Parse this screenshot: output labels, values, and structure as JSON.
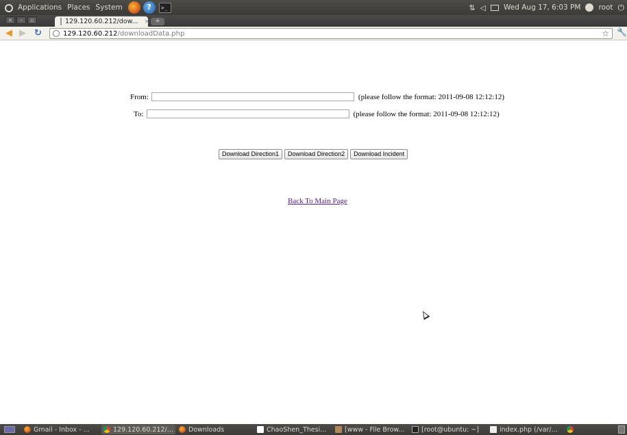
{
  "top_panel": {
    "menus": [
      "Applications",
      "Places",
      "System"
    ],
    "clock": "Wed Aug 17,  6:03 PM",
    "user": "root"
  },
  "browser": {
    "tab_title": "129.120.60.212/dow...",
    "tab_close": "×",
    "url_host": "129.120.60.212",
    "url_path": "/downloadData.php"
  },
  "form": {
    "from_label": "From:",
    "from_value": "",
    "to_label": "To:",
    "to_value": "",
    "format_hint": "(please follow the format: 2011-09-08 12:12:12)",
    "buttons": [
      "Download Direction1",
      "Download Direction2",
      "Download Incident"
    ],
    "back_link": "Back To Main Page"
  },
  "taskbar": {
    "items": [
      {
        "label": "Gmail - Inbox - ...",
        "icon": "firefox-icon"
      },
      {
        "label": "129.120.60.212/...",
        "icon": "chrome-icon"
      },
      {
        "label": "Downloads",
        "icon": "firefox-icon"
      },
      {
        "label": "ChaoShen_Thesi...",
        "icon": "document-icon"
      },
      {
        "label": "[www - File Brow...",
        "icon": "folder-icon"
      },
      {
        "label": "[root@ubuntu: ~]",
        "icon": "terminal-icon"
      },
      {
        "label": "index.php (/var/...",
        "icon": "text-editor-icon"
      },
      {
        "label": "",
        "icon": "chrome-icon"
      }
    ]
  }
}
